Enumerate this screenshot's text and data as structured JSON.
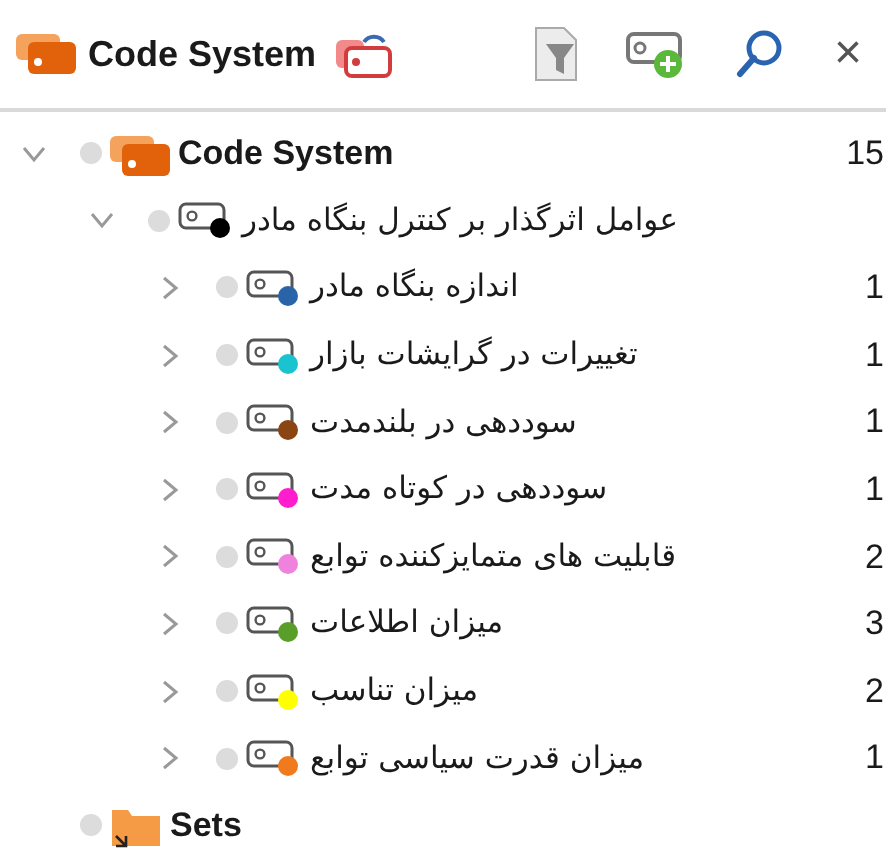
{
  "header": {
    "title": "Code System",
    "close": "×"
  },
  "tree": [
    {
      "kind": "codesystem",
      "label": "Code System",
      "count": "15",
      "expanded": true,
      "children": [
        {
          "kind": "code",
          "label": "عوامل اثرگذار بر کنترل بنگاه مادر",
          "color": "#000000",
          "expanded": true,
          "children": [
            {
              "kind": "code",
              "label": "اندازه بنگاه مادر",
              "color": "#2a64a8",
              "count": "1",
              "expanded": false
            },
            {
              "kind": "code",
              "label": "تغییرات در گرایشات بازار",
              "color": "#19c3d0",
              "count": "1",
              "expanded": false
            },
            {
              "kind": "code",
              "label": "سوددهی در بلندمدت",
              "color": "#8b4513",
              "count": "1",
              "expanded": false
            },
            {
              "kind": "code",
              "label": "سوددهی در کوتاه مدت",
              "color": "#ff1dce",
              "count": "1",
              "expanded": false
            },
            {
              "kind": "code",
              "label": "قابلیت های متمایزکننده توابع",
              "color": "#ee82dc",
              "count": "2",
              "expanded": false
            },
            {
              "kind": "code",
              "label": "میزان اطلاعات",
              "color": "#5a9e2a",
              "count": "3",
              "expanded": false
            },
            {
              "kind": "code",
              "label": "میزان تناسب",
              "color": "#ffff00",
              "count": "2",
              "expanded": false
            },
            {
              "kind": "code",
              "label": "میزان قدرت سیاسی توابع",
              "color": "#f07a1e",
              "count": "1",
              "expanded": false
            }
          ]
        }
      ]
    },
    {
      "kind": "set",
      "label": "Sets"
    }
  ]
}
